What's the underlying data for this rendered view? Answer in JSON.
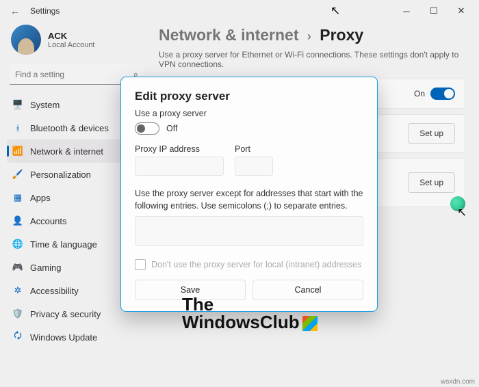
{
  "titlebar": {
    "title": "Settings"
  },
  "profile": {
    "name": "ACK",
    "account": "Local Account"
  },
  "search": {
    "placeholder": "Find a setting"
  },
  "sidebar": {
    "items": [
      {
        "label": "System"
      },
      {
        "label": "Bluetooth & devices"
      },
      {
        "label": "Network & internet"
      },
      {
        "label": "Personalization"
      },
      {
        "label": "Apps"
      },
      {
        "label": "Accounts"
      },
      {
        "label": "Time & language"
      },
      {
        "label": "Gaming"
      },
      {
        "label": "Accessibility"
      },
      {
        "label": "Privacy & security"
      },
      {
        "label": "Windows Update"
      }
    ]
  },
  "breadcrumb": {
    "parent": "Network & internet",
    "current": "Proxy"
  },
  "description": "Use a proxy server for Ethernet or Wi-Fi connections. These settings don't apply to VPN connections.",
  "cards": {
    "toggle_state": "On",
    "setup1": "Set up",
    "setup2": "Set up"
  },
  "dialog": {
    "title": "Edit proxy server",
    "use_label": "Use a proxy server",
    "toggle_state": "Off",
    "ip_label": "Proxy IP address",
    "port_label": "Port",
    "ip_value": "",
    "port_value": "",
    "exceptions_label": "Use the proxy server except for addresses that start with the following entries. Use semicolons (;) to separate entries.",
    "exceptions_value": "",
    "local_checkbox": "Don't use the proxy server for local (intranet) addresses",
    "save": "Save",
    "cancel": "Cancel"
  },
  "watermark": {
    "line1": "The",
    "line2": "WindowsClub"
  },
  "footer": "wsxdn.com"
}
